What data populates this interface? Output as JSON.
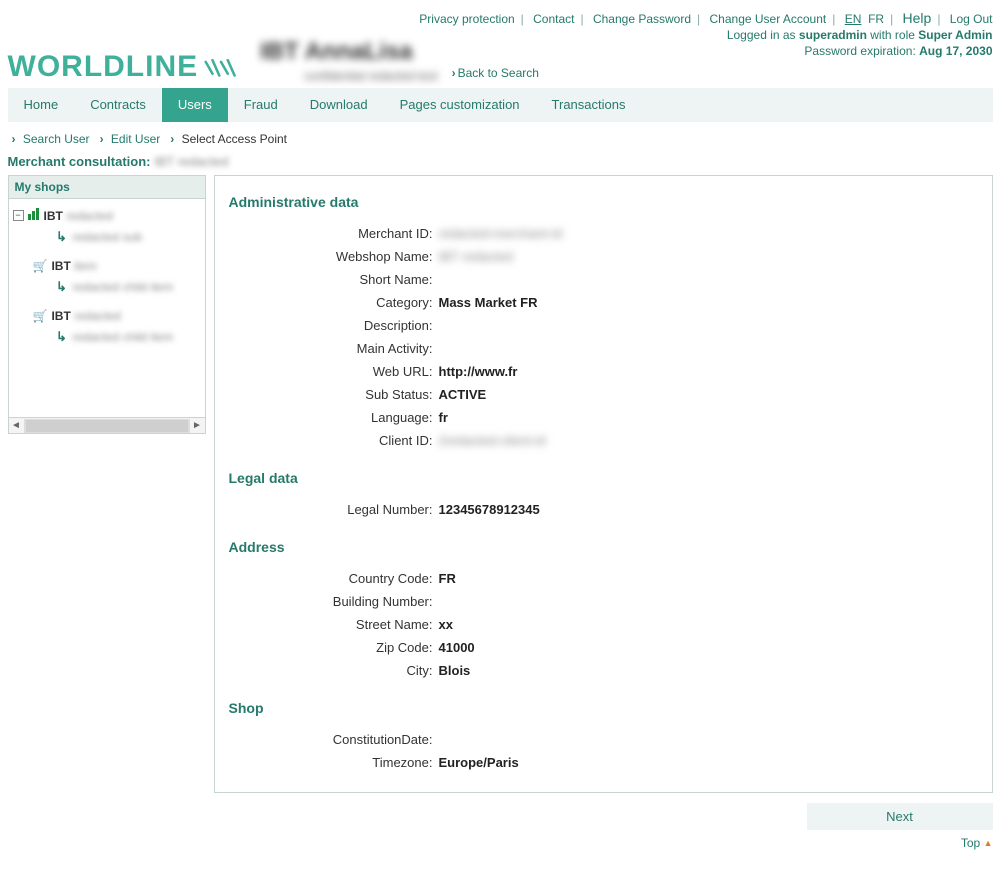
{
  "topLinks": {
    "privacy": "Privacy protection",
    "contact": "Contact",
    "changePassword": "Change Password",
    "changeAccount": "Change User Account",
    "langEN": "EN",
    "langFR": "FR",
    "help": "Help",
    "logout": "Log Out"
  },
  "session": {
    "loggedPrefix": "Logged in as ",
    "user": "superadmin",
    "roleMid": " with role ",
    "role": "Super Admin",
    "expPrefix": "Password expiration: ",
    "expDate": "Aug 17, 2030"
  },
  "logo": {
    "text": "WORLDLINE"
  },
  "userHeader": {
    "title": "IBT AnnaLisa",
    "sub": "confidential redacted text"
  },
  "backSearch": "Back to Search",
  "nav": {
    "home": "Home",
    "contracts": "Contracts",
    "users": "Users",
    "fraud": "Fraud",
    "download": "Download",
    "pages": "Pages customization",
    "transactions": "Transactions"
  },
  "breadcrumb": {
    "search": "Search User",
    "edit": "Edit User",
    "current": "Select Access Point"
  },
  "merchant": {
    "label": "Merchant consultation:",
    "value": "IBT redacted"
  },
  "tree": {
    "header": "My shops",
    "root": "IBT",
    "rootRest": "redacted",
    "node1": "redacted sub",
    "node2": "IBT",
    "node2Rest": "item",
    "node2Sub": "redacted child item",
    "node3": "IBT",
    "node3Rest": "redacted",
    "node3Sub": "redacted child item"
  },
  "sections": {
    "admin": "Administrative data",
    "legal": "Legal data",
    "address": "Address",
    "shop": "Shop"
  },
  "fields": {
    "merchantId": {
      "label": "Merchant ID:",
      "value": "redacted-merchant-id"
    },
    "webshopName": {
      "label": "Webshop Name:",
      "value": "IBT redacted"
    },
    "shortName": {
      "label": "Short Name:",
      "value": ""
    },
    "category": {
      "label": "Category:",
      "value": "Mass Market FR"
    },
    "description": {
      "label": "Description:",
      "value": ""
    },
    "mainActivity": {
      "label": "Main Activity:",
      "value": ""
    },
    "webUrl": {
      "label": "Web URL:",
      "value": "http://www.fr"
    },
    "subStatus": {
      "label": "Sub Status:",
      "value": "ACTIVE"
    },
    "language": {
      "label": "Language:",
      "value": "fr"
    },
    "clientId": {
      "label": "Client ID:",
      "value": "2redacted-client-id"
    },
    "legalNumber": {
      "label": "Legal Number:",
      "value": "12345678912345"
    },
    "countryCode": {
      "label": "Country Code:",
      "value": "FR"
    },
    "buildingNumber": {
      "label": "Building Number:",
      "value": ""
    },
    "streetName": {
      "label": "Street Name:",
      "value": "xx"
    },
    "zipCode": {
      "label": "Zip Code:",
      "value": "41000"
    },
    "city": {
      "label": "City:",
      "value": "Blois"
    },
    "constitutionDate": {
      "label": "ConstitutionDate:",
      "value": ""
    },
    "timezone": {
      "label": "Timezone:",
      "value": "Europe/Paris"
    }
  },
  "buttons": {
    "next": "Next",
    "top": "Top"
  }
}
